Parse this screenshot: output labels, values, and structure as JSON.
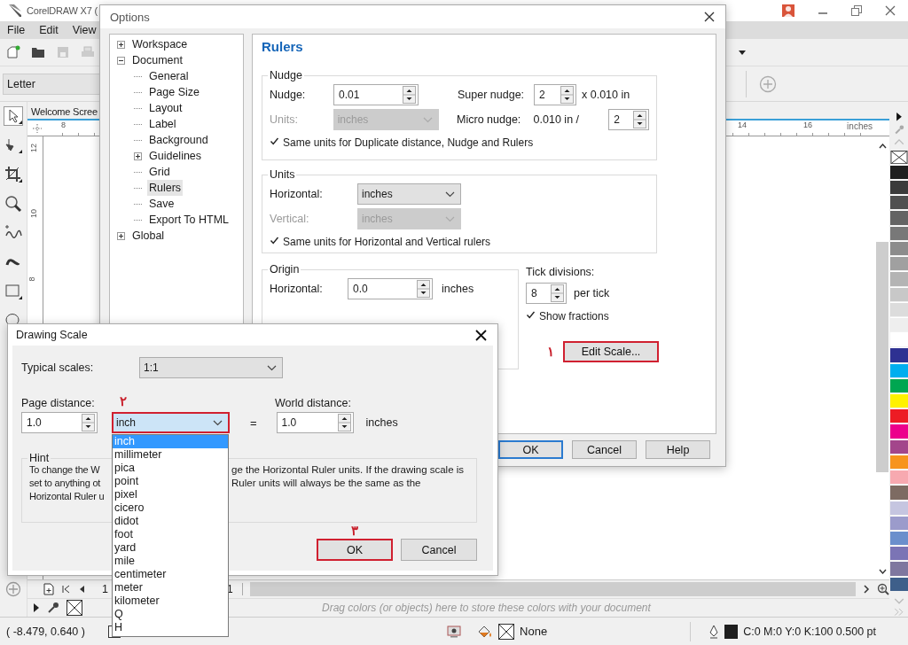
{
  "app": {
    "title": "CorelDRAW X7 (",
    "menu": [
      "File",
      "Edit",
      "View"
    ],
    "page_size": "Letter",
    "doc_tab": "Welcome Scree",
    "hruler_labels": [
      {
        "text": "8",
        "kind": "left"
      },
      {
        "text": "14",
        "kind": "right"
      },
      {
        "text": "16",
        "kind": "right"
      }
    ],
    "ruler_unit": "inches",
    "vruler_labels": [
      "12",
      "10",
      "8"
    ],
    "palette": [
      {
        "color": "#1f1f1f"
      },
      {
        "color": "#3b3b3b"
      },
      {
        "color": "#505050"
      },
      {
        "color": "#646464"
      },
      {
        "color": "#787878"
      },
      {
        "color": "#8c8c8c"
      },
      {
        "color": "#a0a0a0"
      },
      {
        "color": "#b4b4b4"
      },
      {
        "color": "#c8c8c8"
      },
      {
        "color": "#dcdcdc"
      },
      {
        "color": "#eeeeee"
      },
      {
        "color": "#ffffff"
      },
      {
        "color": "#2e3192"
      },
      {
        "color": "#00aeef"
      },
      {
        "color": "#00a651"
      },
      {
        "color": "#fff200"
      },
      {
        "color": "#ed1c24"
      },
      {
        "color": "#ec008c"
      },
      {
        "color": "#a3468b"
      },
      {
        "color": "#f7941d"
      },
      {
        "color": "#f7a9b0"
      },
      {
        "color": "#7d6b62"
      },
      {
        "color": "#c5c5e0"
      },
      {
        "color": "#9b9bcb"
      },
      {
        "color": "#6b8fcc"
      },
      {
        "color": "#7b74b5"
      },
      {
        "color": "#7f779f"
      },
      {
        "color": "#3e5f8a"
      }
    ],
    "page_nav": "1",
    "page_tab": "1",
    "drag_hint": "Drag colors (or objects) here to store these colors with your document",
    "coords": "( -8.479, 0.640 )",
    "fill": "None",
    "outline": "C:0 M:0 Y:0 K:100  0.500 pt"
  },
  "options": {
    "title": "Options",
    "tree": [
      {
        "label": "Workspace",
        "expanded": false,
        "selected": false
      },
      {
        "label": "Document",
        "expanded": true,
        "selected": false,
        "children": [
          {
            "label": "General",
            "selected": false
          },
          {
            "label": "Page Size",
            "selected": false
          },
          {
            "label": "Layout",
            "selected": false
          },
          {
            "label": "Label",
            "selected": false
          },
          {
            "label": "Background",
            "selected": false
          },
          {
            "label": "Guidelines",
            "expanded": false,
            "selected": false
          },
          {
            "label": "Grid",
            "selected": false
          },
          {
            "label": "Rulers",
            "selected": true
          },
          {
            "label": "Save",
            "selected": false
          },
          {
            "label": "Export To HTML",
            "selected": false
          }
        ]
      },
      {
        "label": "Global",
        "expanded": false,
        "selected": false
      }
    ],
    "heading": "Rulers",
    "nudge": {
      "title": "Nudge",
      "nudge_label": "Nudge:",
      "nudge_value": "0.01",
      "units_label": "Units:",
      "units_value": "inches",
      "units_disabled": true,
      "super_label": "Super nudge:",
      "super_value": "2",
      "super_suffix": "x 0.010 in",
      "micro_label": "Micro nudge:",
      "micro_prefix": "0.010 in /",
      "micro_value": "2",
      "same_units": {
        "label": "Same units for Duplicate distance, Nudge and Rulers",
        "checked": true
      }
    },
    "units": {
      "title": "Units",
      "horizontal_label": "Horizontal:",
      "horizontal_value": "inches",
      "horizontal_disabled": false,
      "vertical_label": "Vertical:",
      "vertical_value": "inches",
      "vertical_disabled": true,
      "same_units": {
        "label": "Same units for Horizontal and Vertical rulers",
        "checked": true
      }
    },
    "origin": {
      "title": "Origin",
      "horizontal_label": "Horizontal:",
      "horizontal_value": "0.0",
      "horizontal_unit": "inches"
    },
    "tick": {
      "label": "Tick divisions:",
      "value": "8",
      "suffix": "per tick",
      "show_fractions": {
        "label": "Show fractions",
        "checked": true
      }
    },
    "edit_scale": {
      "label": "Edit Scale...",
      "highlighted": true,
      "marker": "۱"
    },
    "buttons": [
      {
        "label": "OK",
        "default": true
      },
      {
        "label": "Cancel",
        "default": false
      },
      {
        "label": "Help",
        "default": false
      }
    ]
  },
  "drawing_scale": {
    "title": "Drawing Scale",
    "typical_label": "Typical scales:",
    "typical_value": "1:1",
    "page_label": "Page distance:",
    "page_value": "1.0",
    "unit": {
      "value": "inch",
      "highlighted": true,
      "marker": "۲",
      "open": true
    },
    "equals": "=",
    "world_label": "World distance:",
    "world_value": "1.0",
    "world_unit": "inches",
    "hint": {
      "title": "Hint",
      "lines": [
        {
          "left": "To change the W",
          "right": "ge the Horizontal Ruler units.  If the drawing scale is"
        },
        {
          "left": "set to anything ot",
          "right": "Ruler units will always be the same as the"
        },
        {
          "left": "Horizontal Ruler u"
        }
      ]
    },
    "buttons": [
      {
        "label": "OK",
        "highlighted": true,
        "marker": "۳"
      },
      {
        "label": "Cancel",
        "highlighted": false
      }
    ],
    "unit_options": [
      {
        "label": "inch",
        "selected": true
      },
      {
        "label": "millimeter",
        "selected": false
      },
      {
        "label": "pica",
        "selected": false
      },
      {
        "label": "point",
        "selected": false
      },
      {
        "label": "pixel",
        "selected": false
      },
      {
        "label": "cicero",
        "selected": false
      },
      {
        "label": "didot",
        "selected": false
      },
      {
        "label": "foot",
        "selected": false
      },
      {
        "label": "yard",
        "selected": false
      },
      {
        "label": "mile",
        "selected": false
      },
      {
        "label": "centimeter",
        "selected": false
      },
      {
        "label": "meter",
        "selected": false
      },
      {
        "label": "kilometer",
        "selected": false
      },
      {
        "label": "Q",
        "selected": false
      },
      {
        "label": "H",
        "selected": false
      }
    ]
  }
}
